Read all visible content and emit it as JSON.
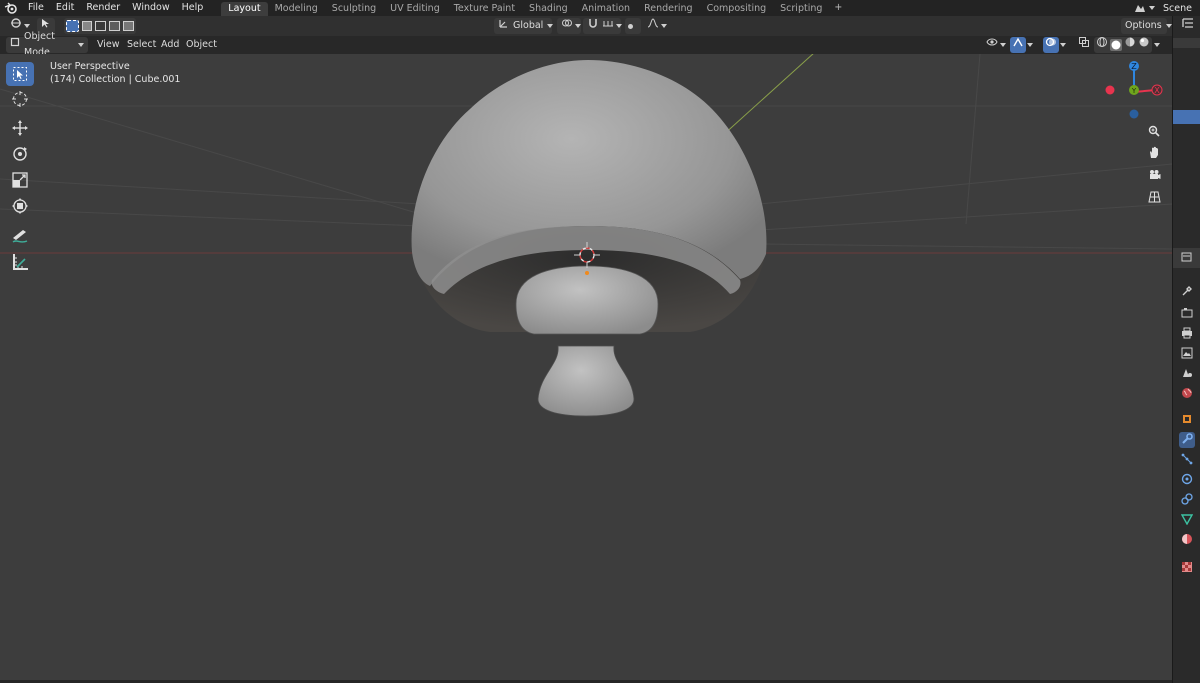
{
  "menubar": {
    "items": [
      "File",
      "Edit",
      "Render",
      "Window",
      "Help"
    ],
    "workspaces": [
      "Layout",
      "Modeling",
      "Sculpting",
      "UV Editing",
      "Texture Paint",
      "Shading",
      "Animation",
      "Rendering",
      "Compositing",
      "Scripting"
    ],
    "active_workspace": "Layout",
    "add_tab": "+",
    "scene_label": "Scene"
  },
  "header": {
    "transform_orientation": "Global",
    "options_label": "Options"
  },
  "header2": {
    "mode": "Object Mode",
    "menus": [
      "View",
      "Select",
      "Add",
      "Object"
    ]
  },
  "viewport": {
    "perspective_label": "User Perspective",
    "object_info": "(174) Collection | Cube.001"
  },
  "gizmo": {
    "z_label": "Z",
    "x_label": "X",
    "y_label": "Y",
    "colors": {
      "x": "#e8344e",
      "y": "#6fa51d",
      "z": "#2f86de"
    }
  },
  "toolshelf": {
    "tools": [
      "select-box",
      "cursor",
      "move",
      "rotate",
      "scale",
      "transform",
      "annotate",
      "measure"
    ],
    "active": "select-box"
  },
  "colors": {
    "accent": "#4772b3",
    "viewport_bg": "#3d3d3d",
    "topbar_bg": "#232323"
  }
}
